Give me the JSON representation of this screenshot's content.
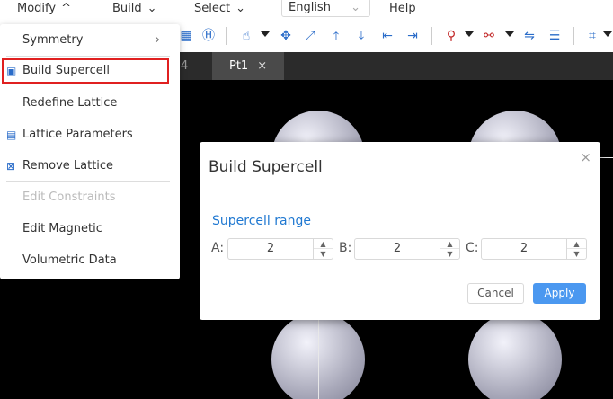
{
  "menubar": {
    "items": [
      {
        "label": "Modify",
        "caret": "^"
      },
      {
        "label": "Build",
        "caret": "⌄"
      },
      {
        "label": "Select",
        "caret": "⌄"
      }
    ],
    "language": "English",
    "help": "Help"
  },
  "toolbar": {
    "icons": [
      "lattice-icon",
      "supercell-icon",
      "pointer-icon",
      "rotate-icon",
      "fit-view-icon",
      "up-arrow-icon",
      "down-arrow-icon",
      "left-arrow-icon",
      "right-arrow-icon",
      "bond-icon",
      "measure-icon",
      "plane-icon",
      "grid-icon",
      "cell-box-icon"
    ]
  },
  "tabs": {
    "partial_label": "4",
    "active_label": "Pt1",
    "close": "×"
  },
  "dropdown": {
    "items": [
      {
        "label": "Symmetry",
        "icon": "",
        "arrow": "›",
        "disabled": false
      },
      {
        "label": "Build Supercell",
        "icon": "supercell-icon",
        "disabled": false
      },
      {
        "label": "Redefine Lattice",
        "icon": "",
        "disabled": false
      },
      {
        "label": "Lattice Parameters",
        "icon": "lattice-params-icon",
        "disabled": false
      },
      {
        "label": "Remove Lattice",
        "icon": "remove-lattice-icon",
        "disabled": false
      },
      {
        "label": "Edit Constraints",
        "icon": "",
        "disabled": true
      },
      {
        "label": "Edit Magnetic",
        "icon": "",
        "disabled": false
      },
      {
        "label": "Volumetric Data",
        "icon": "",
        "disabled": false
      }
    ]
  },
  "dialog": {
    "title": "Build Supercell",
    "close": "×",
    "range_title": "Supercell range",
    "axes": [
      {
        "label": "A:",
        "value": "2"
      },
      {
        "label": "B:",
        "value": "2"
      },
      {
        "label": "C:",
        "value": "2"
      }
    ],
    "cancel": "Cancel",
    "apply": "Apply"
  },
  "colors": {
    "accent": "#4b98f0",
    "link": "#1f78d1",
    "highlight": "#e02020",
    "viewport_bg": "#000000"
  }
}
